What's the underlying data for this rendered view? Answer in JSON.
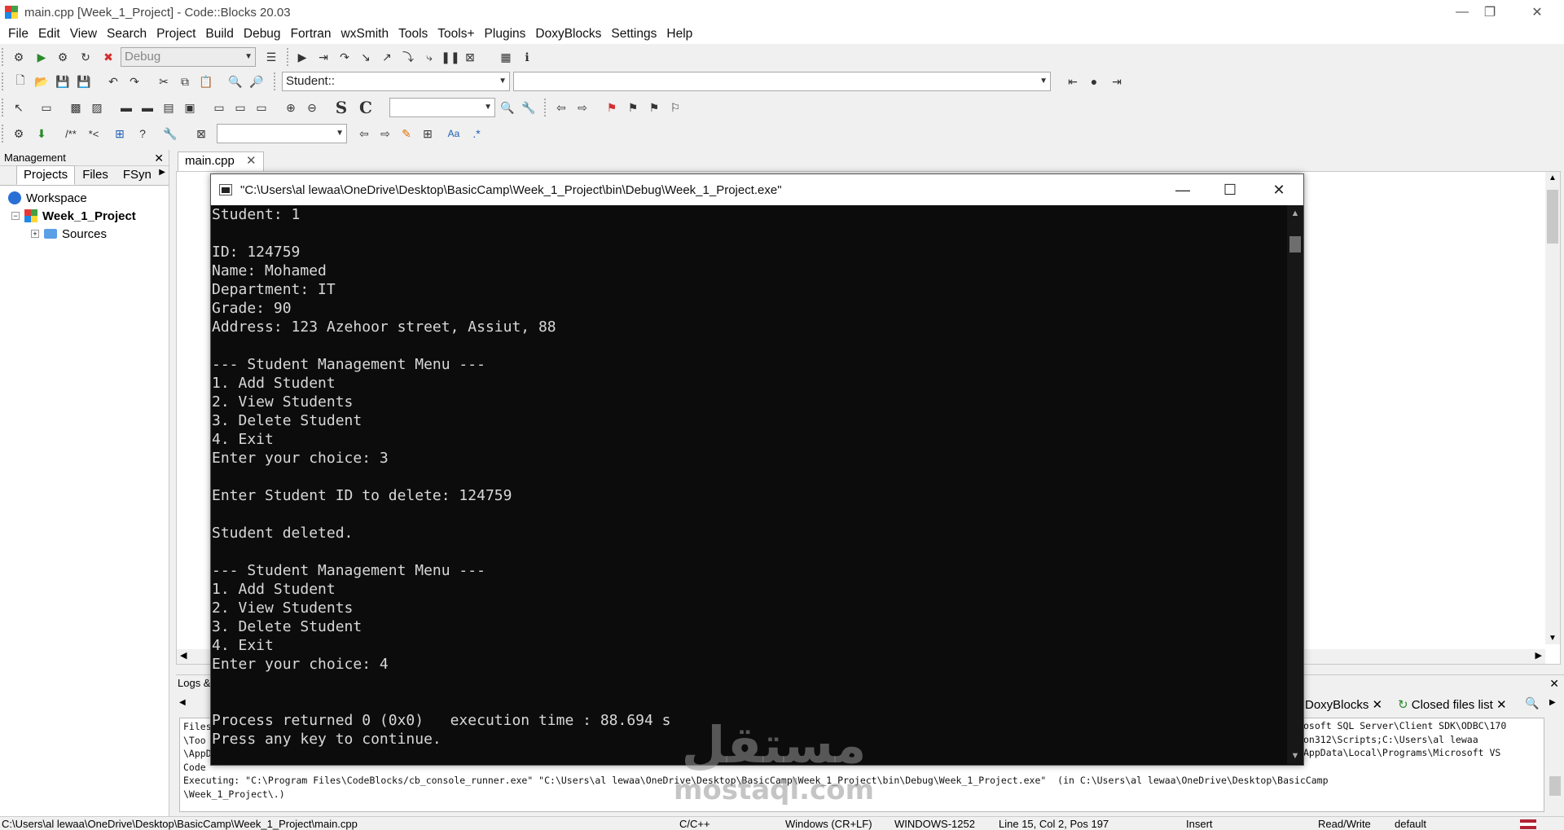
{
  "window": {
    "title": "main.cpp [Week_1_Project] - Code::Blocks 20.03",
    "minimize": "—",
    "maximize": "❐",
    "close": "✕"
  },
  "menu": [
    "File",
    "Edit",
    "View",
    "Search",
    "Project",
    "Build",
    "Debug",
    "Fortran",
    "wxSmith",
    "Tools",
    "Tools+",
    "Plugins",
    "DoxyBlocks",
    "Settings",
    "Help"
  ],
  "toolbar": {
    "build_target": "Debug",
    "scope": "Student::",
    "function": "",
    "search_text": "",
    "find_text": ""
  },
  "management": {
    "title": "Management",
    "close": "✕",
    "tabs": [
      "Projects",
      "Files",
      "FSyn"
    ],
    "tree": {
      "workspace": "Workspace",
      "project": "Week_1_Project",
      "sources": "Sources"
    }
  },
  "editor": {
    "tab_label": "main.cpp",
    "tab_close": "✕"
  },
  "console": {
    "title": "\"C:\\Users\\al lewaa\\OneDrive\\Desktop\\BasicCamp\\Week_1_Project\\bin\\Debug\\Week_1_Project.exe\"",
    "output": "Student: 1\n\nID: 124759\nName: Mohamed\nDepartment: IT\nGrade: 90\nAddress: 123 Azehoor street, Assiut, 88\n\n--- Student Management Menu ---\n1. Add Student\n2. View Students\n3. Delete Student\n4. Exit\nEnter your choice: 3\n\nEnter Student ID to delete: 124759\n\nStudent deleted.\n\n--- Student Management Menu ---\n1. Add Student\n2. View Students\n3. Delete Student\n4. Exit\nEnter your choice: 4\n\n\nProcess returned 0 (0x0)   execution time : 88.694 s\nPress any key to continue."
  },
  "logs": {
    "title": "Logs &",
    "close": "✕",
    "tabs": [
      "DoxyBlocks",
      "Closed files list"
    ],
    "content": "Files\n\\Too\n\\AppD\nCode\nExecuting: \"C:\\Program Files\\CodeBlocks/cb_console_runner.exe\" \"C:\\Users\\al lewaa\\OneDrive\\Desktop\\BasicCamp\\Week_1_Project\\bin\\Debug\\Week_1_Project.exe\"  (in C:\\Users\\al lewaa\\OneDrive\\Desktop\\BasicCamp\n\\Week_1_Project\\.)",
    "right_fragments": [
      "osoft SQL Server\\Client SDK\\ODBC\\170",
      "on312\\Scripts;C:\\Users\\al lewaa",
      "AppData\\Local\\Programs\\Microsoft VS"
    ]
  },
  "statusbar": {
    "path": "C:\\Users\\al lewaa\\OneDrive\\Desktop\\BasicCamp\\Week_1_Project\\main.cpp",
    "language": "C/C++",
    "eol": "Windows (CR+LF)",
    "encoding": "WINDOWS-1252",
    "position": "Line 15, Col 2, Pos 197",
    "mode": "Insert",
    "access": "Read/Write",
    "profile": "default"
  },
  "watermark": {
    "arabic": "مستقل",
    "latin": "mostaql.com"
  },
  "colors": {
    "console_bg": "#0c0c0c",
    "console_fg": "#d8d8d8",
    "chrome_bg": "#f0f0f0"
  }
}
